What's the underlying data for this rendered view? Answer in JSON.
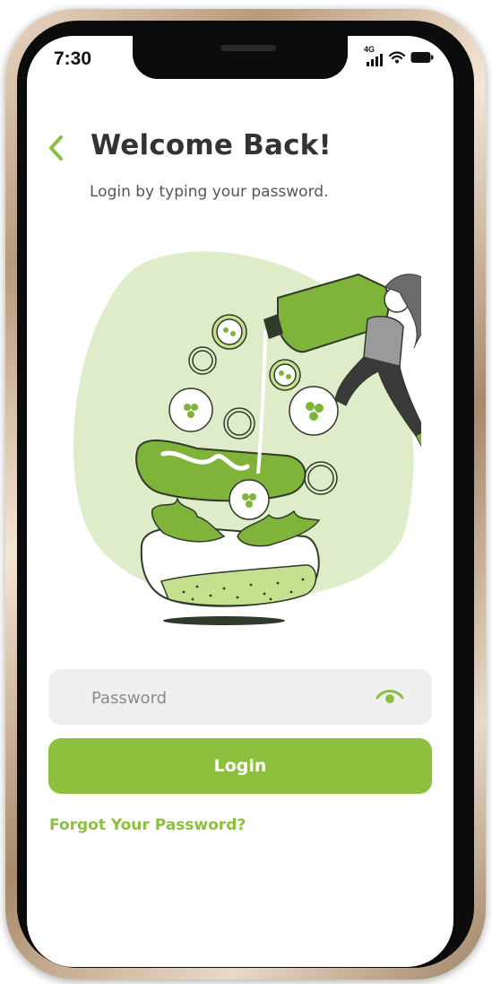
{
  "status_bar": {
    "time": "7:30",
    "network": "4G",
    "icons": [
      "signal-icon",
      "wifi-icon",
      "battery-icon"
    ]
  },
  "header": {
    "back_icon": "chevron-left-icon",
    "title": "Welcome Back!",
    "subtitle": "Login by typing your password."
  },
  "illustration": {
    "description_icon": "salad-sauce-illustration"
  },
  "form": {
    "password_placeholder": "Password",
    "password_value": "",
    "visibility_icon": "eye-icon",
    "login_label": "Login",
    "forgot_label": "Forgot Your Password?"
  },
  "theme": {
    "accent": "#8dbf3f",
    "light_accent": "#dfecc9",
    "title_color": "#333333",
    "field_bg": "#efefef"
  }
}
